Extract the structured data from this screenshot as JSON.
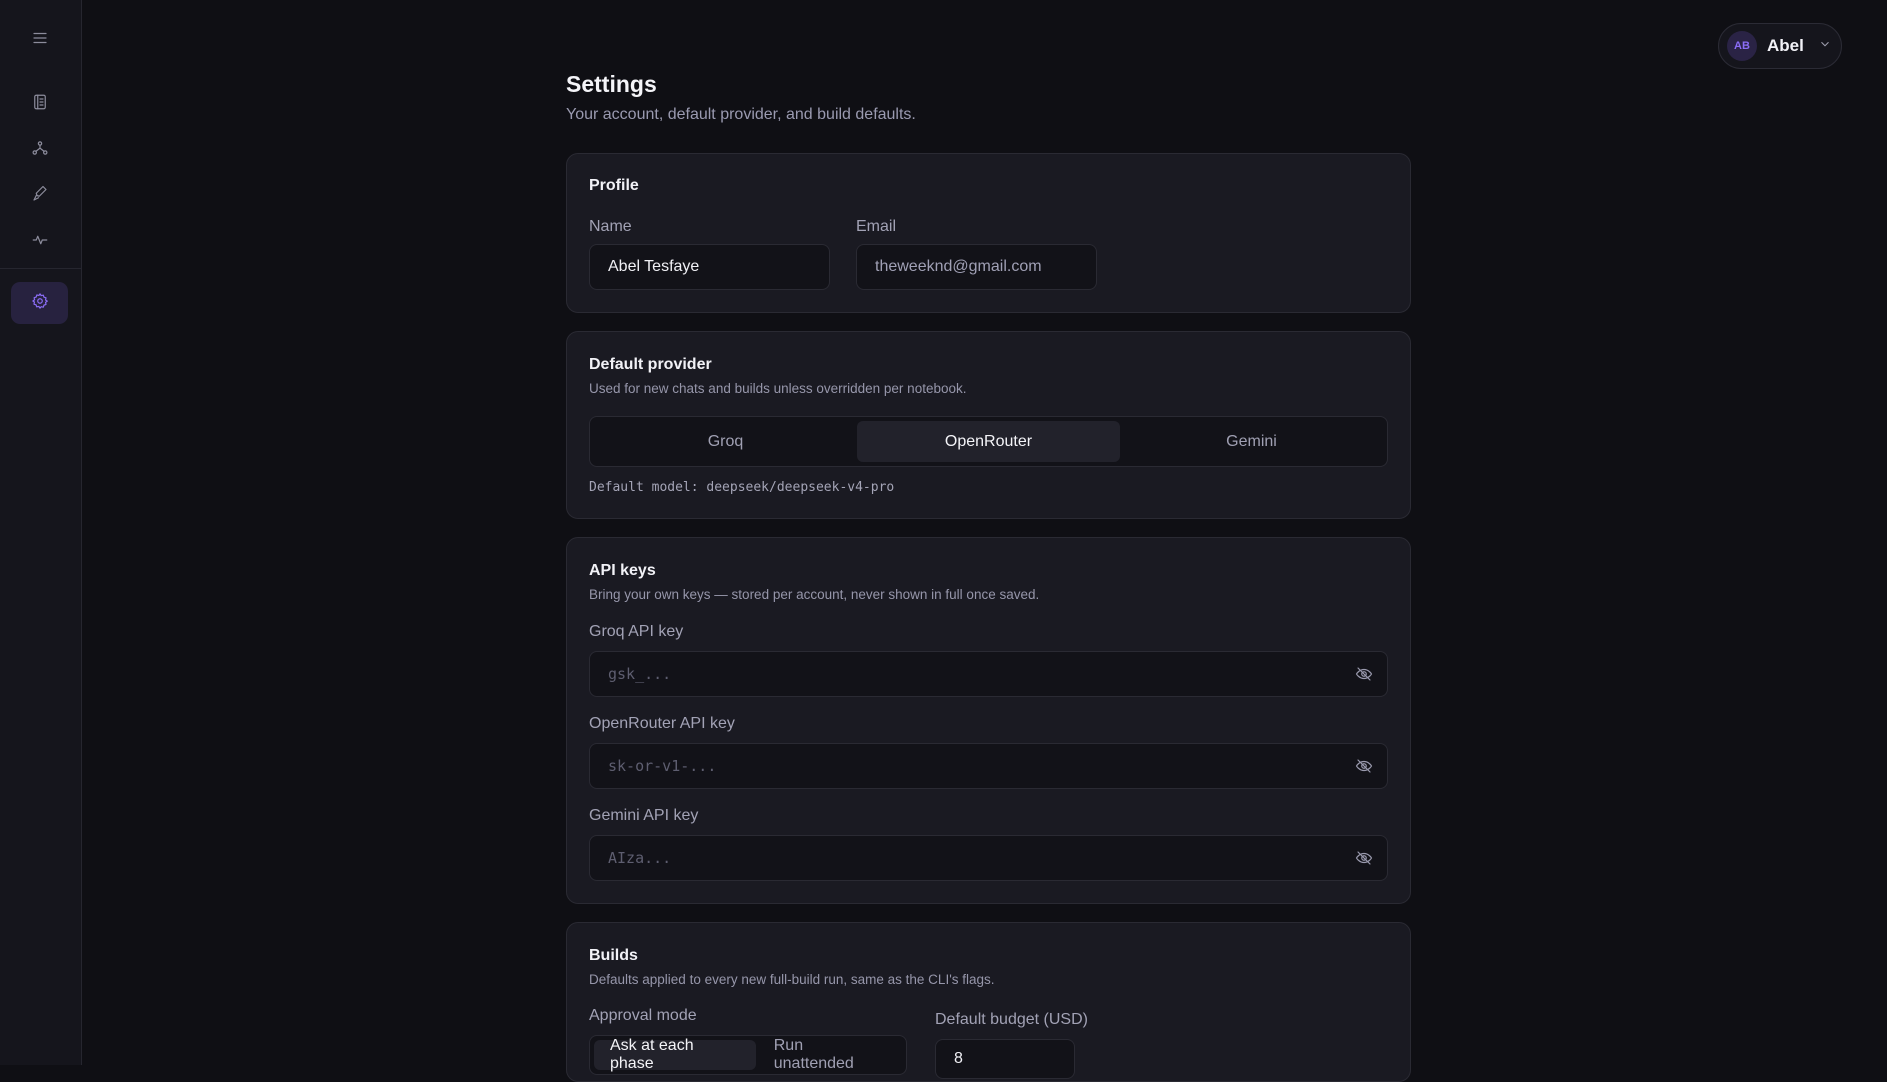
{
  "sidebar": {
    "items": [
      {
        "name": "menu-icon"
      },
      {
        "name": "notebook-icon"
      },
      {
        "name": "graph-icon"
      },
      {
        "name": "tools-icon"
      },
      {
        "name": "activity-icon"
      },
      {
        "name": "settings-icon",
        "active": true
      }
    ]
  },
  "user": {
    "initials": "AB",
    "name": "Abel"
  },
  "page": {
    "title": "Settings",
    "subtitle": "Your account, default provider, and build defaults."
  },
  "profile": {
    "title": "Profile",
    "name_label": "Name",
    "name_value": "Abel Tesfaye",
    "email_label": "Email",
    "email_value": "theweeknd@gmail.com"
  },
  "provider": {
    "title": "Default provider",
    "description": "Used for new chats and builds unless overridden per notebook.",
    "options": [
      "Groq",
      "OpenRouter",
      "Gemini"
    ],
    "selected": "OpenRouter",
    "default_model": "Default model: deepseek/deepseek-v4-pro"
  },
  "api_keys": {
    "title": "API keys",
    "description": "Bring your own keys — stored per account, never shown in full once saved.",
    "fields": [
      {
        "label": "Groq API key",
        "placeholder": "gsk_..."
      },
      {
        "label": "OpenRouter API key",
        "placeholder": "sk-or-v1-..."
      },
      {
        "label": "Gemini API key",
        "placeholder": "AIza..."
      }
    ]
  },
  "builds": {
    "title": "Builds",
    "description": "Defaults applied to every new full-build run, same as the CLI's flags.",
    "approval_label": "Approval mode",
    "approval_options": [
      "Ask at each phase",
      "Run unattended"
    ],
    "approval_selected": "Ask at each phase",
    "budget_label": "Default budget (USD)",
    "budget_value": "8"
  },
  "colors": {
    "accent": "#8b6df6",
    "background": "#0f0f14",
    "card": "#1a1a22"
  }
}
